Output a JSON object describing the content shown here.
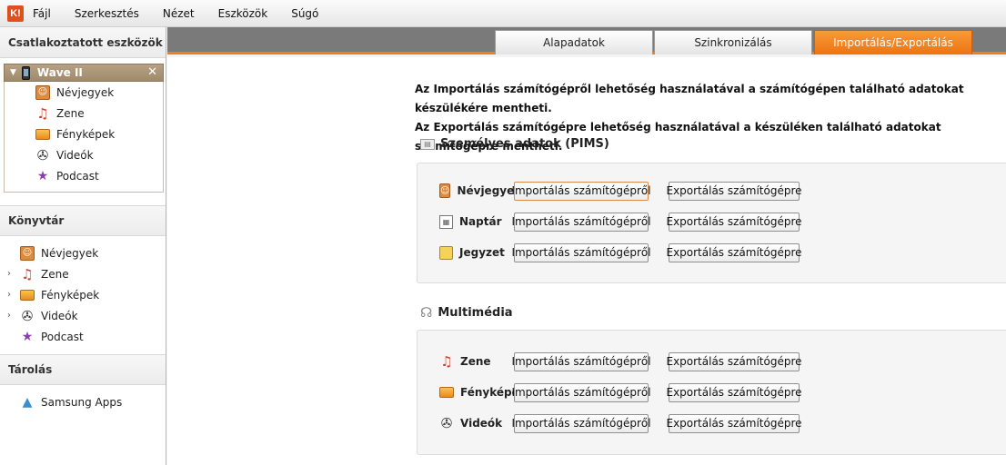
{
  "app": {
    "logo_text": "K!"
  },
  "menu": [
    "Fájl",
    "Szerkesztés",
    "Nézet",
    "Eszközök",
    "Súgó"
  ],
  "sidebar": {
    "connected_header": "Csatlakoztatott eszközök",
    "device": {
      "name": "Wave II",
      "items": [
        "Névjegyek",
        "Zene",
        "Fényképek",
        "Videók",
        "Podcast"
      ]
    },
    "library_header": "Könyvtár",
    "library_items": [
      "Névjegyek",
      "Zene",
      "Fényképek",
      "Videók",
      "Podcast"
    ],
    "storage_header": "Tárolás",
    "storage_items": [
      "Samsung Apps"
    ]
  },
  "tabs": [
    "Alapadatok",
    "Szinkronizálás",
    "Importálás/Exportálás"
  ],
  "active_tab": "Importálás/Exportálás",
  "intro": {
    "line1": "Az Importálás számítógépről lehetőség használatával a számítógépen található adatokat készülékére mentheti.",
    "line2": "Az Exportálás számítógépre lehetőség használatával a készüléken található adatokat számítógépre mentheti."
  },
  "pims": {
    "title": "Személyes adatok (PIMS)",
    "rows": [
      "Névjegyek",
      "Naptár",
      "Jegyzet"
    ]
  },
  "multimedia": {
    "title": "Multimédia",
    "rows": [
      "Zene",
      "Fényképek",
      "Videók"
    ]
  },
  "buttons": {
    "import": "Importálás számítógépről",
    "export": "Exportálás számítógépre"
  },
  "colors": {
    "accent": "#ef7f1a",
    "tabstrip": "#7a7a7a"
  }
}
